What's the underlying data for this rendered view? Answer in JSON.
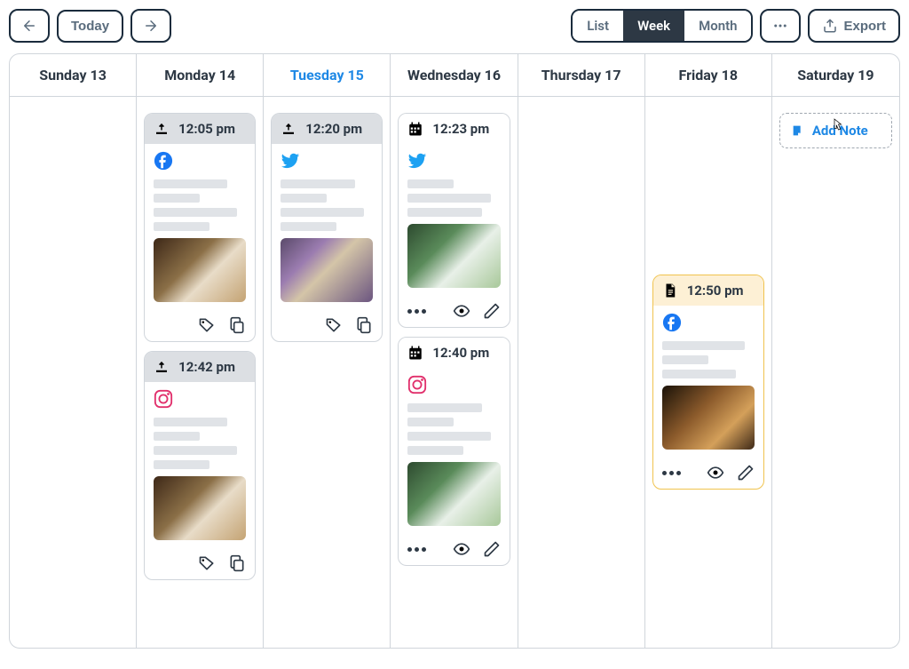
{
  "toolbar": {
    "today_label": "Today",
    "views": {
      "list": "List",
      "week": "Week",
      "month": "Month"
    },
    "active_view": "Week",
    "export_label": "Export"
  },
  "days": [
    {
      "label": "Sunday 13",
      "is_today": false
    },
    {
      "label": "Monday 14",
      "is_today": false
    },
    {
      "label": "Tuesday 15",
      "is_today": true
    },
    {
      "label": "Wednesday 16",
      "is_today": false
    },
    {
      "label": "Thursday 17",
      "is_today": false
    },
    {
      "label": "Friday 18",
      "is_today": false
    },
    {
      "label": "Saturday 19",
      "is_today": false
    }
  ],
  "cards": {
    "mon1": {
      "time": "12:05 pm",
      "platform": "facebook",
      "status": "sent",
      "thumb": "coffee"
    },
    "mon2": {
      "time": "12:42 pm",
      "platform": "instagram",
      "status": "sent",
      "thumb": "coffee"
    },
    "tue1": {
      "time": "12:20 pm",
      "platform": "twitter",
      "status": "sent",
      "thumb": "flower"
    },
    "wed1": {
      "time": "12:23 pm",
      "platform": "twitter",
      "status": "scheduled",
      "thumb": "green"
    },
    "wed2": {
      "time": "12:40 pm",
      "platform": "instagram",
      "status": "scheduled",
      "thumb": "green"
    },
    "fri1": {
      "time": "12:50 pm",
      "platform": "facebook",
      "status": "draft",
      "thumb": "whiskey"
    }
  },
  "add_note_label": "Add Note",
  "icons": {
    "platforms": {
      "facebook": "facebook-icon",
      "twitter": "twitter-icon",
      "instagram": "instagram-icon"
    }
  }
}
